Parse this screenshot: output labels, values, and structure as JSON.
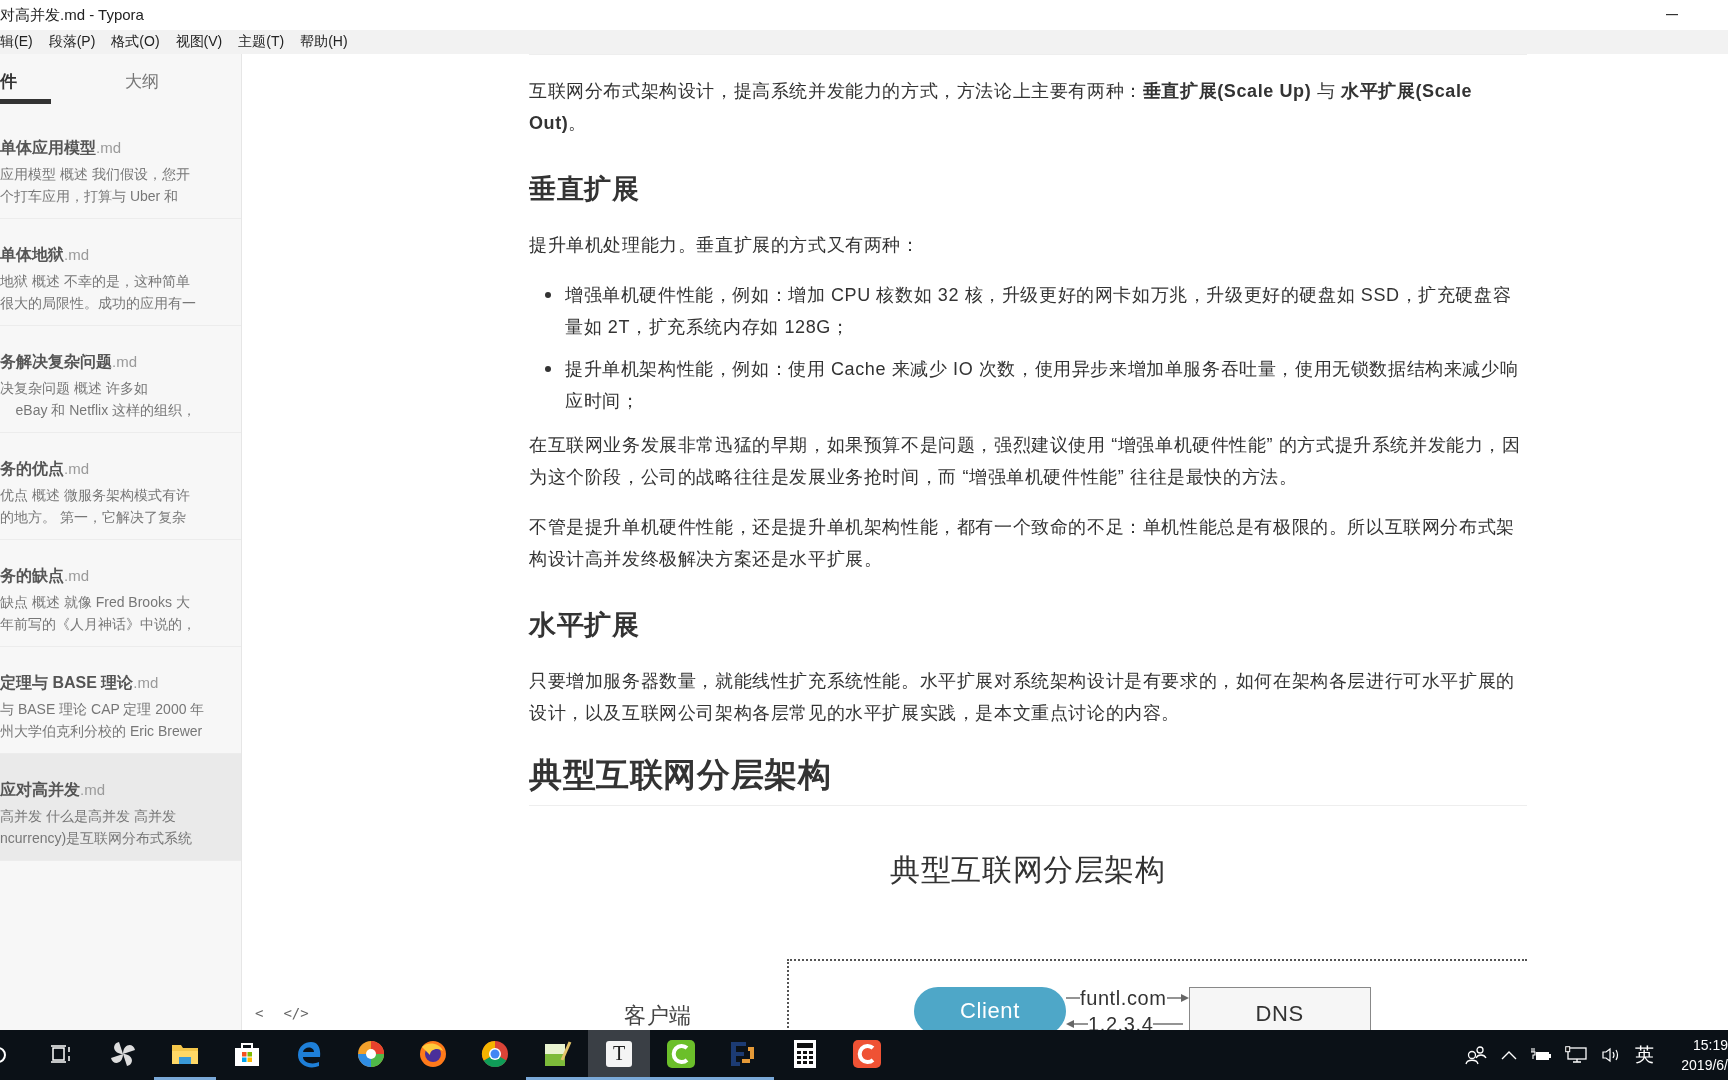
{
  "window": {
    "title": "对高并发.md - Typora"
  },
  "menu": [
    "辑(E)",
    "段落(P)",
    "格式(O)",
    "视图(V)",
    "主题(T)",
    "帮助(H)"
  ],
  "sidebar": {
    "tabs": [
      {
        "label": "件",
        "selected": true
      },
      {
        "label": "大纲",
        "selected": false
      }
    ],
    "files": [
      {
        "title": "单体应用模型",
        "ext": ".md",
        "excerpt": [
          "应用模型 概述 我们假设，您开",
          "个打车应用，打算与 Uber 和"
        ],
        "selected": false
      },
      {
        "title": "单体地狱",
        "ext": ".md",
        "excerpt": [
          "地狱 概述 不幸的是，这种简单",
          "很大的局限性。成功的应用有一"
        ],
        "selected": false
      },
      {
        "title": "务解决复杂问题",
        "ext": ".md",
        "excerpt": [
          "决复杂问题 概述 许多如",
          "    eBay 和 Netflix 这样的组织，"
        ],
        "selected": false
      },
      {
        "title": "务的优点",
        "ext": ".md",
        "excerpt": [
          "优点 概述 微服务架构模式有许",
          "的地方。 第一，它解决了复杂"
        ],
        "selected": false
      },
      {
        "title": "务的缺点",
        "ext": ".md",
        "excerpt": [
          "缺点 概述 就像 Fred Brooks 大",
          "年前写的《人月神话》中说的，"
        ],
        "selected": false
      },
      {
        "title": "定理与 BASE 理论",
        "ext": ".md",
        "excerpt": [
          "与 BASE 理论 CAP 定理 2000 年",
          "州大学伯克利分校的 Eric Brewer"
        ],
        "selected": false
      },
      {
        "title": "应对高并发",
        "ext": ".md",
        "excerpt": [
          "高并发 什么是高并发 高并发",
          "ncurrency)是互联网分布式系统"
        ],
        "selected": true
      }
    ],
    "footer": {
      "back": "<",
      "source": "</>"
    }
  },
  "document": [
    {
      "kind": "p",
      "text": "互联网分布式架构设计，提高系统并发能力的方式，方法论上主要有两种：**垂直扩展(Scale Up)** 与 **水平扩展(Scale Out)**。"
    },
    {
      "kind": "h2",
      "text": "垂直扩展"
    },
    {
      "kind": "p",
      "text": "提升单机处理能力。垂直扩展的方式又有两种："
    },
    {
      "kind": "ul",
      "items": [
        "增强单机硬件性能，例如：增加 CPU 核数如 32 核，升级更好的网卡如万兆，升级更好的硬盘如 SSD，扩充硬盘容量如 2T，扩充系统内存如 128G；",
        "提升单机架构性能，例如：使用 Cache 来减少 IO 次数，使用异步来增加单服务吞吐量，使用无锁数据结构来减少响应时间；"
      ]
    },
    {
      "kind": "p",
      "text": "在互联网业务发展非常迅猛的早期，如果预算不是问题，强烈建议使用 “增强单机硬件性能” 的方式提升系统并发能力，因为这个阶段，公司的战略往往是发展业务抢时间，而 “增强单机硬件性能” 往往是最快的方法。"
    },
    {
      "kind": "p",
      "text": "不管是提升单机硬件性能，还是提升单机架构性能，都有一个致命的不足：单机性能总是有极限的。所以互联网分布式架构设计高并发终极解决方案还是水平扩展。"
    },
    {
      "kind": "h2",
      "text": "水平扩展"
    },
    {
      "kind": "p",
      "text": "只要增加服务器数量，就能线性扩充系统性能。水平扩展对系统架构设计是有要求的，如何在架构各层进行可水平扩展的设计，以及互联网公司架构各层常见的水平扩展实践，是本文重点讨论的内容。"
    },
    {
      "kind": "h1",
      "text": "典型互联网分层架构"
    },
    {
      "kind": "figure",
      "title": "典型互联网分层架构",
      "layer": "客户端",
      "client": "Client",
      "server": "DNS",
      "request": "funtl.com",
      "response": "1.2.3.4"
    }
  ],
  "taskbar": {
    "apps": [
      {
        "kind": "taskview",
        "running": false,
        "active": false
      },
      {
        "kind": "pinwheel",
        "running": false,
        "active": false
      },
      {
        "kind": "folder",
        "running": true,
        "active": false
      },
      {
        "kind": "store",
        "running": false,
        "active": false
      },
      {
        "kind": "edge",
        "running": false,
        "active": false
      },
      {
        "kind": "swirl",
        "running": false,
        "active": false
      },
      {
        "kind": "firefox",
        "running": false,
        "active": false
      },
      {
        "kind": "chrome",
        "running": false,
        "active": false
      },
      {
        "kind": "notepad",
        "running": true,
        "active": false
      },
      {
        "kind": "typora",
        "running": true,
        "active": true,
        "glyph": "T"
      },
      {
        "kind": "greenc",
        "running": true,
        "active": false
      },
      {
        "kind": "bracket",
        "running": true,
        "active": false
      },
      {
        "kind": "calculator",
        "running": false,
        "active": false
      },
      {
        "kind": "redc",
        "running": false,
        "active": false
      }
    ],
    "ime": "英",
    "time": "15:19",
    "date": "2019/6/"
  }
}
